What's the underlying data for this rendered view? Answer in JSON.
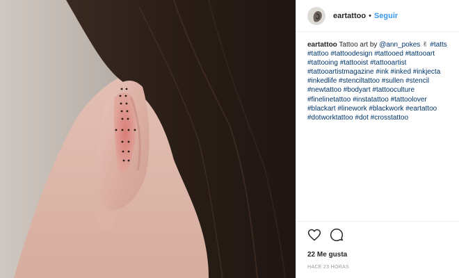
{
  "post": {
    "image_alt": "ear tattoo photo"
  },
  "header": {
    "username": "eartattoo",
    "separator": "•",
    "follow_label": "Seguir"
  },
  "caption": {
    "username": "eartattoo",
    "text_prefix": "Tattoo art by ",
    "mention": "@ann_pokes",
    "emoji": "✌",
    "hashtags": [
      "#tatts",
      "#tattoo",
      "#tattoodesign",
      "#tattooed",
      "#tattooart",
      "#tattooing",
      "#tattooist",
      "#tattooartist",
      "#tattooartistmagazine",
      "#ink",
      "#inked",
      "#inkjecta",
      "#inkedlife",
      "#stenciltattoo",
      "#sullen",
      "#stencil",
      "#newtattoo",
      "#bodyart",
      "#tattooculture",
      "#finelinetattoo",
      "#instatattoo",
      "#tattoolover",
      "#blackart",
      "#linework",
      "#blackwork",
      "#eartattoo",
      "#dotworktattoo",
      "#dot",
      "#crosstattoo"
    ]
  },
  "actions": {
    "likes": "22 Me gusta",
    "time": "HACE 23 HORAS"
  },
  "colors": {
    "follow": "#3897f0",
    "link": "#003569",
    "text": "#262626",
    "muted": "#999999"
  },
  "icons": {
    "like": "heart-icon",
    "comment": "comment-icon"
  }
}
